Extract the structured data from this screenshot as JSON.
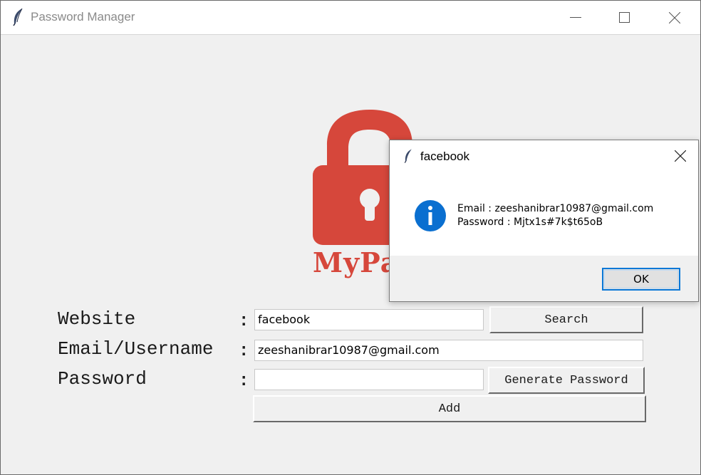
{
  "window": {
    "title": "Password Manager",
    "icons": {
      "app": "feather-icon",
      "minimize": "minimize-icon",
      "maximize": "maximize-icon",
      "close": "close-icon"
    }
  },
  "logo": {
    "text": "MyPa",
    "icon": "padlock-icon",
    "color": "#d6473b"
  },
  "form": {
    "website_label": "Website",
    "email_label": "Email/Username",
    "password_label": "Password",
    "colon": ":",
    "website_value": "facebook",
    "email_value": "zeeshanibrar10987@gmail.com",
    "password_value": "",
    "search_label": "Search",
    "generate_label": "Generate Password",
    "add_label": "Add"
  },
  "dialog": {
    "title": "facebook",
    "icon": "info-icon",
    "line1": "Email : zeeshanibrar10987@gmail.com",
    "line2": "Password : Mjtx1s#7k$t65oB",
    "ok_label": "OK",
    "accent": "#0a78d7"
  }
}
